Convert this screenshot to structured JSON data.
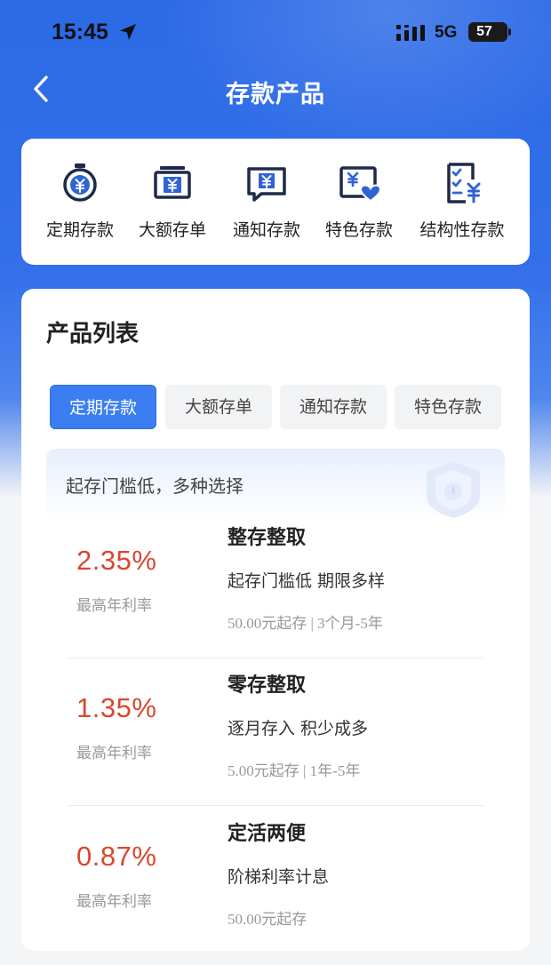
{
  "status_bar": {
    "time": "15:45",
    "network": "5G",
    "battery": "57",
    "battery_level_percent": 57
  },
  "header": {
    "title": "存款产品",
    "back_icon": "chevron-left-icon"
  },
  "categories": [
    {
      "label": "定期存款",
      "icon": "stopwatch-yuan-icon"
    },
    {
      "label": "大额存单",
      "icon": "certificate-yuan-icon"
    },
    {
      "label": "通知存款",
      "icon": "message-yuan-icon"
    },
    {
      "label": "特色存款",
      "icon": "card-heart-yuan-icon"
    },
    {
      "label": "结构性存款",
      "icon": "checklist-yuan-icon"
    }
  ],
  "product_list": {
    "title": "产品列表",
    "tabs": [
      {
        "label": "定期存款",
        "active": true
      },
      {
        "label": "大额存单",
        "active": false
      },
      {
        "label": "通知存款",
        "active": false
      },
      {
        "label": "特色存款",
        "active": false
      }
    ],
    "banner": "起存门槛低，多种选择",
    "items": [
      {
        "rate": "2.35%",
        "rate_label": "最高年利率",
        "name": "整存整取",
        "desc": "起存门槛低  期限多样",
        "meta": "50.00元起存 | 3个月-5年"
      },
      {
        "rate": "1.35%",
        "rate_label": "最高年利率",
        "name": "零存整取",
        "desc": "逐月存入  积少成多",
        "meta": "5.00元起存 | 1年-5年"
      },
      {
        "rate": "0.87%",
        "rate_label": "最高年利率",
        "name": "定活两便",
        "desc": "阶梯利率计息",
        "meta": "50.00元起存"
      }
    ]
  },
  "colors": {
    "brand_blue": "#2c6ae6",
    "active_tab": "#3a7ef2",
    "rate_red": "#d9472f",
    "icon_navy": "#1f2a4a",
    "icon_blue": "#2f63d6"
  }
}
